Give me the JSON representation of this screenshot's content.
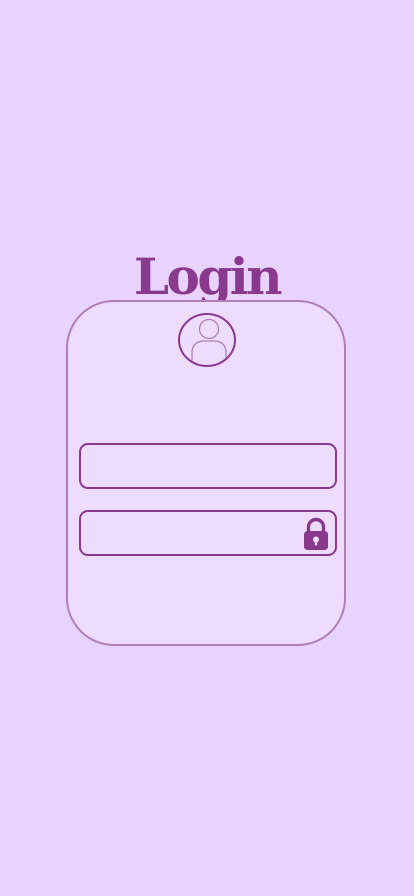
{
  "page": {
    "title": "Login"
  },
  "form": {
    "username": {
      "value": "",
      "placeholder": ""
    },
    "password": {
      "value": "",
      "placeholder": ""
    }
  },
  "icons": {
    "avatar": "user-silhouette-icon",
    "password": "lock-icon"
  },
  "colors": {
    "background": "#e8d3fe",
    "card": "#eedcff",
    "accent": "#8a3a8e",
    "card_border": "#b07fb8"
  }
}
